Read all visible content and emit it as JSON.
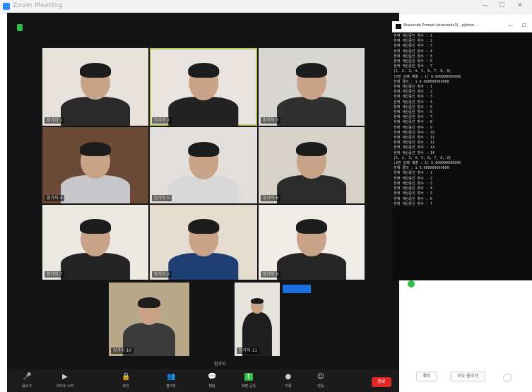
{
  "window": {
    "title": "Zoom Meeting",
    "controls": [
      "—",
      "☐",
      "✕"
    ]
  },
  "gallery": {
    "tiles": [
      {
        "name": "참가자 1",
        "active": false,
        "bg": "#e7e2dc",
        "shirt": "#2a2a2a"
      },
      {
        "name": "참가자 2",
        "active": true,
        "bg": "#e9e4df",
        "shirt": "#232323"
      },
      {
        "name": "참가자 3",
        "active": false,
        "bg": "#d9d7d4",
        "shirt": "#303030"
      },
      {
        "name": "참가자 4",
        "active": false,
        "bg": "#6b4a38",
        "shirt": "#c8c8cc"
      },
      {
        "name": "참가자 5",
        "active": false,
        "bg": "#e2dfdc",
        "shirt": "#d8d8d8"
      },
      {
        "name": "참가자 6",
        "active": false,
        "bg": "#d6d2c8",
        "shirt": "#2b2b2b"
      },
      {
        "name": "참가자 7",
        "active": false,
        "bg": "#ece8e2",
        "shirt": "#242424"
      },
      {
        "name": "참가자 8",
        "active": false,
        "bg": "#e5ddcf",
        "shirt": "#1f3f74"
      },
      {
        "name": "참가자 9",
        "active": false,
        "bg": "#f0ece8",
        "shirt": "#262626"
      },
      {
        "name": "참가자 10",
        "active": false,
        "bg": "#b7a98a",
        "shirt": "#3a3a3a"
      },
      {
        "name": "참가자 11",
        "active": false,
        "bg": "#e7e3df",
        "shirt": "#1e1e1e"
      }
    ],
    "side_label": "참가자"
  },
  "toolbar": {
    "buttons": [
      {
        "label": "음소거",
        "icon": "🎤"
      },
      {
        "label": "비디오 시작",
        "icon": "▶"
      },
      {
        "label": "보안",
        "icon": "🔒"
      },
      {
        "label": "참가자",
        "icon": "👥"
      },
      {
        "label": "채팅",
        "icon": "💬"
      },
      {
        "label": "화면 공유",
        "icon": "⬆"
      },
      {
        "label": "기록",
        "icon": "●"
      },
      {
        "label": "반응",
        "icon": "☺"
      }
    ],
    "end_label": "종료"
  },
  "console": {
    "title": "Anaconda Prompt (anaconda3) - python ...",
    "controls": [
      "—",
      "☐"
    ],
    "lines": [
      "현재 계산중인 횟수 : 1",
      "현재 계산중인 횟수 : 2",
      "현재 계산중인 횟수 : 3",
      "현재 계산중인 횟수 : 4",
      "현재 계산중인 횟수 : 5",
      "현재 계산중인 횟수 : 6",
      "현재 계산중인 횟수 : 7",
      "[1, 2, 3, 4, 5, 6, 7, 8, 9]",
      "(3번 실패 제출 : 1) 0.000000000000",
      "현재 결과 : 1 0.000000000000",
      "현재 계산중인 횟수 : 1",
      "현재 계산중인 횟수 : 2",
      "현재 계산중인 횟수 : 3",
      "현재 계산중인 횟수 : 4",
      "현재 계산중인 횟수 : 5",
      "현재 계산중인 횟수 : 6",
      "현재 계산중인 횟수 : 7",
      "현재 계산중인 횟수 : 8",
      "현재 계산중인 횟수 : 9",
      "현재 계산중인 횟수 : 10",
      "현재 계산중인 횟수 : 11",
      "현재 계산중인 횟수 : 12",
      "현재 계산중인 횟수 : 13",
      "현재 계산중인 횟수 : 14",
      "[1, 2, 3, 4, 5, 6, 7, 8, 9]",
      "(3번 실패 제출 : 1) 0.000000000000",
      "현재 결과 : 1 0.000000000000",
      "현재 계산중인 횟수 : 1",
      "현재 계산중인 횟수 : 2",
      "현재 계산중인 횟수 : 3",
      "현재 계산중인 횟수 : 4",
      "현재 계산중인 횟수 : 5",
      "현재 계산중인 횟수 : 6",
      "현재 계산중인 횟수 : 7"
    ]
  },
  "right_panel": {
    "btn_left": "취소",
    "btn_right": "모두 음소거"
  }
}
